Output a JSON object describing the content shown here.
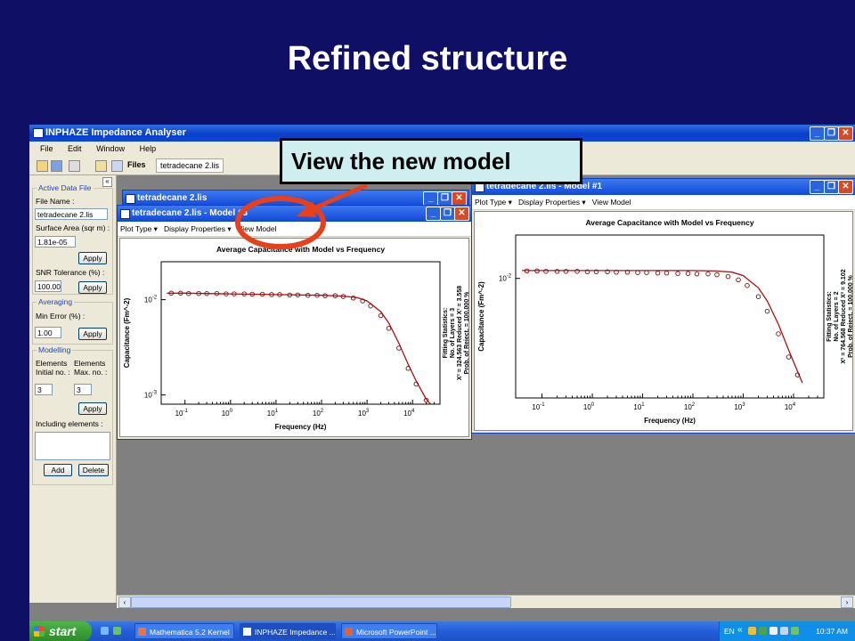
{
  "slide": {
    "title": "Refined structure"
  },
  "callout": {
    "text": "View the new model"
  },
  "app": {
    "title": "INPHAZE Impedance Analyser",
    "menu": [
      "File",
      "Edit",
      "Window",
      "Help"
    ],
    "toolbar": {
      "files_label": "Files",
      "file_tab": "tetradecane 2.lis"
    }
  },
  "sidebar": {
    "collapse_glyph": "«",
    "active_data_file": {
      "group_label": "Active Data File",
      "file_name_label": "File Name :",
      "file_name_value": "tetradecane 2.lis",
      "surface_area_label": "Surface Area (sqr m) :",
      "surface_area_value": "1.81e-05",
      "apply_label": "Apply",
      "snr_label": "SNR Tolerance (%) :",
      "snr_value": "100.00",
      "snr_apply_label": "Apply"
    },
    "averaging": {
      "group_label": "Averaging",
      "min_error_label": "Min Error (%) :",
      "min_error_value": "1.00",
      "apply_label": "Apply"
    },
    "modelling": {
      "group_label": "Modelling",
      "elements_label_1": "Elements",
      "elements_label_2": "Elements",
      "initial_label": "Initial no. :",
      "max_label": "Max. no. :",
      "initial_value": "3",
      "max_value": "3",
      "apply_label": "Apply",
      "including_label": "Including elements :",
      "add_label": "Add",
      "delete_label": "Delete"
    }
  },
  "windows": {
    "back_left": {
      "title": "tetradecane 2.lis"
    },
    "front_left": {
      "title": "tetradecane 2.lis - Model #3"
    },
    "right": {
      "title": "tetradecane 2.lis - Model #1"
    },
    "plot_menu": {
      "plot_type": "Plot Type",
      "display_properties": "Display Properties",
      "view_model": "View Model"
    }
  },
  "chart_data": [
    {
      "type": "scatter",
      "title": "Average Capacitance with Model vs Frequency",
      "xlabel": "Frequency (Hz)",
      "ylabel": "Capacitance (Fm^-2)",
      "xscale": "log",
      "yscale": "log",
      "xlim": [
        0.03,
        40000
      ],
      "ylim": [
        0.0008,
        0.025
      ],
      "x_ticks": [
        "10^-1",
        "10^0",
        "10^1",
        "10^2",
        "10^3",
        "10^4"
      ],
      "y_ticks": [
        "10^-2",
        "10^-3"
      ],
      "series": [
        {
          "name": "data",
          "x": [
            0.05,
            0.08,
            0.12,
            0.2,
            0.3,
            0.5,
            0.8,
            1.2,
            2,
            3,
            5,
            8,
            12,
            20,
            30,
            50,
            80,
            120,
            200,
            300,
            500,
            800,
            1200,
            2000,
            3000,
            5000,
            8000,
            12000,
            20000
          ],
          "values": [
            0.0117,
            0.0117,
            0.0116,
            0.0116,
            0.0116,
            0.0116,
            0.0115,
            0.0115,
            0.0115,
            0.0114,
            0.0114,
            0.0113,
            0.0113,
            0.0112,
            0.0112,
            0.0111,
            0.0111,
            0.011,
            0.011,
            0.0108,
            0.0104,
            0.0097,
            0.0086,
            0.0068,
            0.005,
            0.0031,
            0.0019,
            0.0013,
            0.00088
          ]
        },
        {
          "name": "model",
          "x": [
            0.04,
            0.1,
            1,
            10,
            100,
            300,
            600,
            1000,
            2000,
            3000,
            5000,
            8000,
            12000,
            20000,
            25000
          ],
          "values": [
            0.0117,
            0.0117,
            0.0115,
            0.0113,
            0.0111,
            0.0109,
            0.0105,
            0.0097,
            0.0075,
            0.0057,
            0.0035,
            0.0021,
            0.0014,
            0.0009,
            0.0008
          ]
        }
      ],
      "stats": {
        "heading": "Fitting Statistics:",
        "line1": "No. of Layers = 3",
        "line2": "X² = 324.563    Reduced X² = 3.558",
        "line3": "Prob. of Reject. = 100.000 %"
      }
    },
    {
      "type": "scatter",
      "title": "Average Capacitance with Model vs Frequency",
      "xlabel": "Frequency (Hz)",
      "ylabel": "Capacitance (Fm^-2)",
      "xscale": "log",
      "yscale": "log",
      "xlim": [
        0.03,
        40000
      ],
      "ylim": [
        0.0008,
        0.025
      ],
      "x_ticks": [
        "10^-1",
        "10^0",
        "10^1",
        "10^2",
        "10^3",
        "10^4"
      ],
      "y_ticks": [
        "10^-2"
      ],
      "series": [
        {
          "name": "data",
          "x": [
            0.05,
            0.08,
            0.12,
            0.2,
            0.3,
            0.5,
            0.8,
            1.2,
            2,
            3,
            5,
            8,
            12,
            20,
            30,
            50,
            80,
            120,
            200,
            300,
            500,
            800,
            1200,
            2000,
            3000,
            5000,
            8000,
            12000
          ],
          "values": [
            0.0117,
            0.0117,
            0.0116,
            0.0116,
            0.0116,
            0.0116,
            0.0115,
            0.0115,
            0.0115,
            0.0114,
            0.0114,
            0.0113,
            0.0113,
            0.0112,
            0.0112,
            0.0111,
            0.0111,
            0.011,
            0.011,
            0.0108,
            0.0104,
            0.0097,
            0.0086,
            0.0068,
            0.005,
            0.0031,
            0.0019,
            0.0013
          ]
        },
        {
          "name": "model",
          "x": [
            0.04,
            0.1,
            1,
            10,
            100,
            300,
            600,
            1000,
            2000,
            3000,
            5000,
            8000,
            12000,
            15000
          ],
          "values": [
            0.0118,
            0.0118,
            0.0118,
            0.0118,
            0.0118,
            0.0117,
            0.0114,
            0.0106,
            0.0082,
            0.0062,
            0.0038,
            0.0022,
            0.0014,
            0.0011
          ]
        }
      ],
      "stats": {
        "heading": "Fitting Statistics:",
        "line1": "No. of Layers = 2",
        "line2": "X² = 764.568    Reduced X² = 9.102",
        "line3": "Prob. of Reject. = 100.000 %"
      }
    }
  ],
  "taskbar": {
    "start_label": "start",
    "tasks": [
      "Mathematica 5.2 Kernel",
      "INPHAZE Impedance ...",
      "Microsoft PowerPoint ..."
    ],
    "lang": "EN",
    "clock": "10:37 AM"
  }
}
